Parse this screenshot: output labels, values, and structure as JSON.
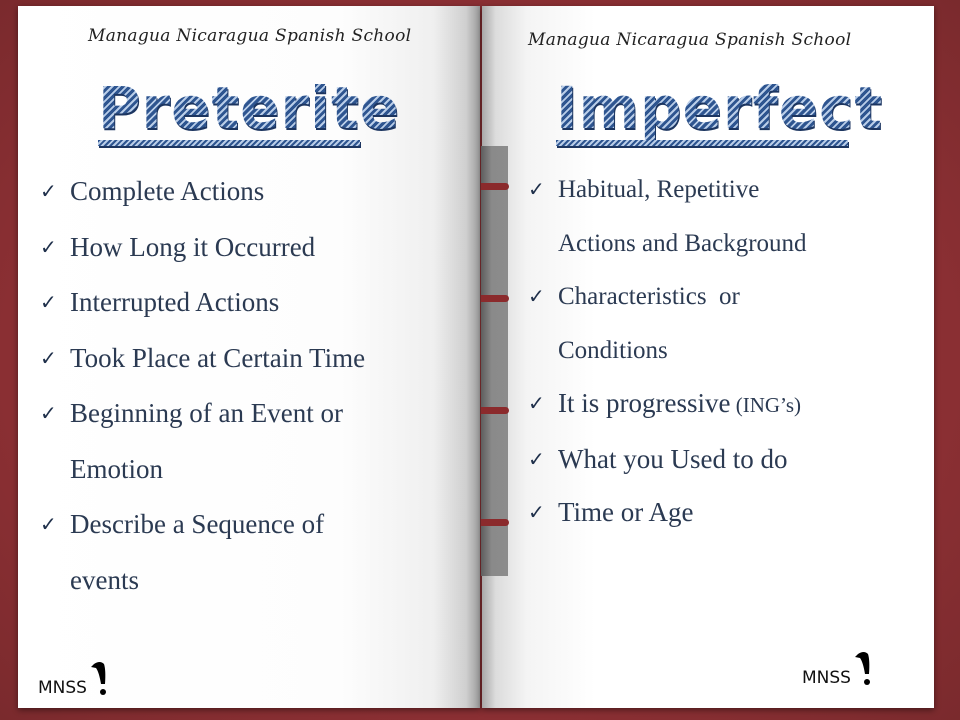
{
  "school_name": "Managua Nicaragua Spanish School",
  "left_page": {
    "title": "Preterite",
    "items": [
      {
        "text": "Complete Actions"
      },
      {
        "text": "How Long it Occurred"
      },
      {
        "text": "Interrupted Actions"
      },
      {
        "text": "Took Place at Certain Time"
      },
      {
        "text": "Beginning of an Event or",
        "continuation": "Emotion"
      },
      {
        "text": "Describe a Sequence of",
        "continuation": "events"
      }
    ],
    "logo_text": "MNSS"
  },
  "right_page": {
    "title": "Imperfect",
    "items": [
      {
        "text": "Habitual, Repetitive",
        "continuation": "Actions and Background"
      },
      {
        "text": "Characteristics  or",
        "continuation": "Conditions"
      },
      {
        "text": "It is progressive",
        "suffix": " (ING’s)"
      },
      {
        "text": "What you Used to do"
      },
      {
        "text": "Time or Age"
      }
    ],
    "logo_text": "MNSS"
  },
  "icons": {
    "check": "✓",
    "logo": "bird-exclamation-icon"
  },
  "colors": {
    "cover": "#8e3236",
    "title_blue": "#2e5590",
    "text": "#2b3a52",
    "ribbon": "#8b2a2c"
  }
}
